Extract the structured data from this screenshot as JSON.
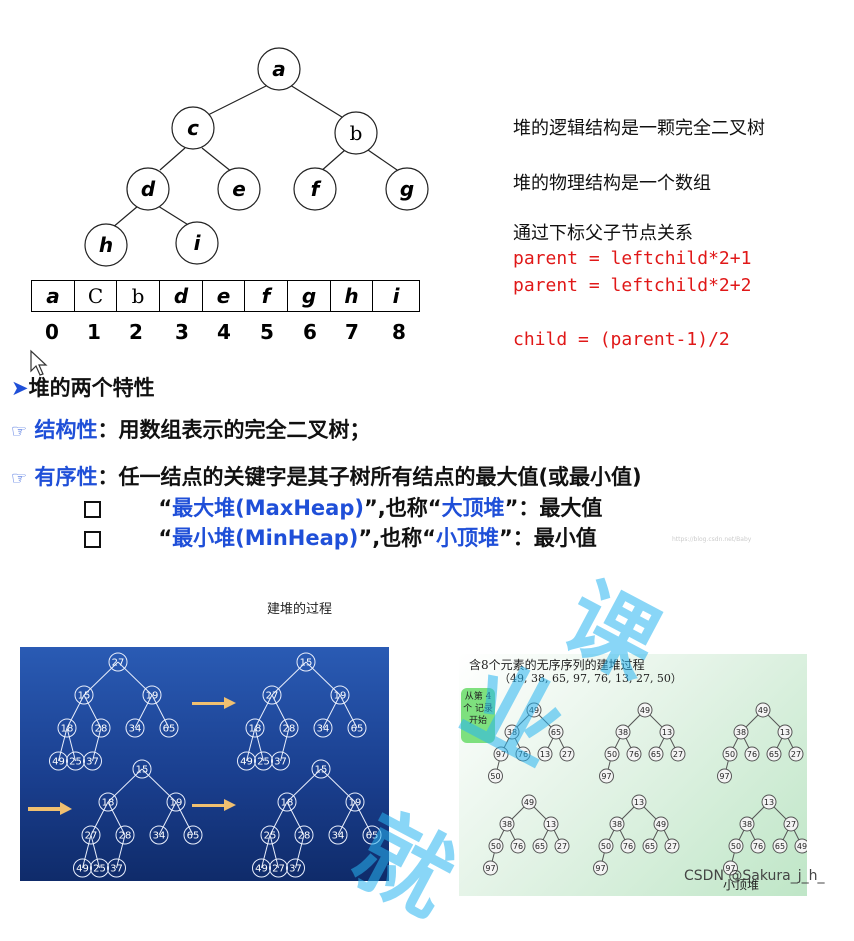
{
  "tree": {
    "nodes": [
      "a",
      "c",
      "b",
      "d",
      "e",
      "f",
      "g",
      "h",
      "i"
    ]
  },
  "array": {
    "cells": [
      "a",
      "C",
      "b",
      "d",
      "e",
      "f",
      "g",
      "h",
      "i"
    ],
    "indices": [
      "0",
      "1",
      "2",
      "3",
      "4",
      "5",
      "6",
      "7",
      "8"
    ]
  },
  "explain": {
    "logic": "堆的逻辑结构是一颗完全二叉树",
    "physical": "堆的物理结构是一个数组",
    "relation": "通过下标父子节点关系",
    "code1": "parent = leftchild*2+1",
    "code2": "parent = leftchild*2+2",
    "code3": "child = (parent-1)/2"
  },
  "properties": {
    "heading": "堆的两个特性",
    "structure_label": "结构性",
    "structure_text": "：用数组表示的完全二叉树；",
    "order_label": "有序性",
    "order_text": "：任一结点的关键字是其子树所有结点的最大值(或最小值)",
    "max_q1": "“",
    "max_name": "最大堆(MaxHeap)",
    "max_mid": "”,也称“",
    "max_alias": "大顶堆",
    "max_tail": "”：最大值",
    "min_q1": "“",
    "min_name": "最小堆(MinHeap)",
    "min_mid": "”,也称“",
    "min_alias": "小顶堆",
    "min_tail": "”：最小值",
    "faint": "https://blog.csdn.net/Baby"
  },
  "build": {
    "caption": "建堆的过程"
  },
  "left_panel": {
    "trees": [
      [
        "27",
        "15",
        "19",
        "18",
        "28",
        "34",
        "65",
        "49",
        "25",
        "37"
      ],
      [
        "15",
        "27",
        "19",
        "18",
        "28",
        "34",
        "65",
        "49",
        "25",
        "37"
      ],
      [
        "15",
        "18",
        "19",
        "27",
        "28",
        "34",
        "65",
        "49",
        "25",
        "37"
      ],
      [
        "15",
        "18",
        "19",
        "25",
        "28",
        "34",
        "65",
        "49",
        "27",
        "37"
      ]
    ]
  },
  "right_panel": {
    "title": "含8个元素的无序序列的建堆过程",
    "sequence": "（49, 38, 65, 97, 76, 13, 27, 50）",
    "start_note": "从第 4 个 记录 开始",
    "trees": [
      [
        "49",
        "38",
        "65",
        "97",
        "76",
        "13",
        "27",
        "50"
      ],
      [
        "49",
        "38",
        "13",
        "50",
        "76",
        "65",
        "27",
        "97"
      ],
      [
        "49",
        "38",
        "13",
        "50",
        "76",
        "65",
        "27",
        "97"
      ],
      [
        "49",
        "38",
        "13",
        "50",
        "76",
        "65",
        "27",
        "97"
      ],
      [
        "13",
        "38",
        "49",
        "50",
        "76",
        "65",
        "27",
        "97"
      ],
      [
        "13",
        "38",
        "27",
        "50",
        "76",
        "65",
        "49",
        "97"
      ]
    ],
    "footer": "小顶堆"
  },
  "watermark": {
    "text1": "就",
    "text2": "业",
    "text3": "课",
    "credit": "CSDN @Sakura_j_h_"
  },
  "colors": {
    "code_red": "#e01818",
    "label_blue": "#1f4fd8",
    "panel_blue": "#1a3f8f",
    "panel_green": "#bfe6c7"
  }
}
